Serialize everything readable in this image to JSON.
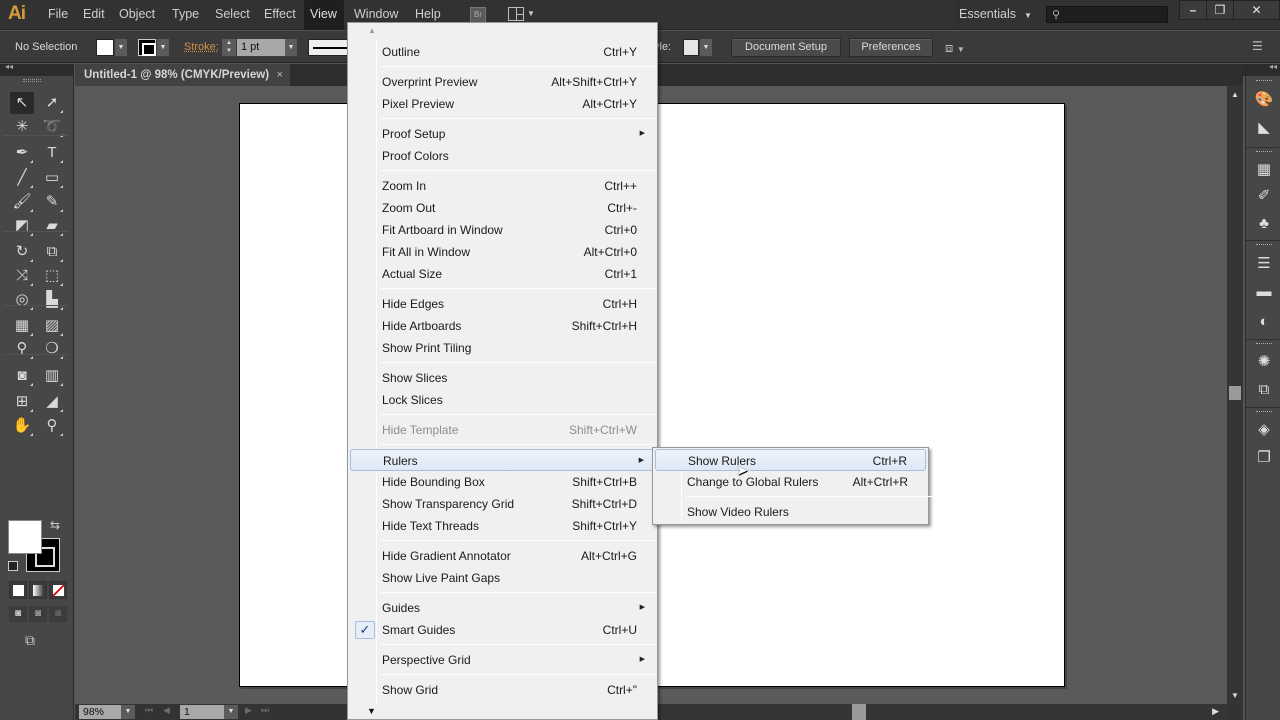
{
  "app": {
    "logo": "Ai",
    "menus": [
      {
        "label": "File"
      },
      {
        "label": "Edit"
      },
      {
        "label": "Object"
      },
      {
        "label": "Type"
      },
      {
        "label": "Select"
      },
      {
        "label": "Effect"
      },
      {
        "label": "View",
        "active": true
      },
      {
        "label": "Window"
      },
      {
        "label": "Help"
      }
    ],
    "bridge_label": "Br",
    "workspace": "Essentials",
    "search_placeholder": "",
    "window_controls": {
      "minimize": "–",
      "restore": "❐",
      "close": "✕"
    }
  },
  "controlbar": {
    "selection_status": "No Selection",
    "stroke_label": "Stroke:",
    "stroke_weight": "1 pt",
    "style_label": "yle:",
    "document_setup_label": "Document Setup",
    "preferences_label": "Preferences"
  },
  "document": {
    "tab_title": "Untitled-1 @ 98% (CMYK/Preview)",
    "tab_close": "×"
  },
  "statusbar": {
    "zoom": "98%",
    "artboard_number": "1"
  },
  "tools": [
    {
      "name": "selection-tool",
      "glyph": "↖",
      "selected": true
    },
    {
      "name": "direct-selection-tool",
      "glyph": "➚"
    },
    {
      "name": "magic-wand-tool",
      "glyph": "✳"
    },
    {
      "name": "lasso-tool",
      "glyph": "➰"
    },
    {
      "name": "pen-tool",
      "glyph": "✒"
    },
    {
      "name": "type-tool",
      "glyph": "T"
    },
    {
      "name": "line-segment-tool",
      "glyph": "╱"
    },
    {
      "name": "rectangle-tool",
      "glyph": "▭"
    },
    {
      "name": "paintbrush-tool",
      "glyph": "🖌"
    },
    {
      "name": "pencil-tool",
      "glyph": "✎"
    },
    {
      "name": "blob-brush-tool",
      "glyph": "◩"
    },
    {
      "name": "eraser-tool",
      "glyph": "▰"
    },
    {
      "name": "rotate-tool",
      "glyph": "↻"
    },
    {
      "name": "scale-tool",
      "glyph": "⧉"
    },
    {
      "name": "width-tool",
      "glyph": "⤨"
    },
    {
      "name": "free-transform-tool",
      "glyph": "⬚"
    },
    {
      "name": "shape-builder-tool",
      "glyph": "◎"
    },
    {
      "name": "perspective-grid-tool",
      "glyph": "▙"
    },
    {
      "name": "mesh-tool",
      "glyph": "▦"
    },
    {
      "name": "gradient-tool",
      "glyph": "▨"
    },
    {
      "name": "eyedropper-tool",
      "glyph": "⚲"
    },
    {
      "name": "blend-tool",
      "glyph": "❍"
    },
    {
      "name": "symbol-sprayer-tool",
      "glyph": "◙"
    },
    {
      "name": "column-graph-tool",
      "glyph": "▥"
    },
    {
      "name": "artboard-tool",
      "glyph": "⊞"
    },
    {
      "name": "slice-tool",
      "glyph": "◢"
    },
    {
      "name": "hand-tool",
      "glyph": "✋"
    },
    {
      "name": "zoom-tool",
      "glyph": "⚲"
    }
  ],
  "dock_panels": [
    {
      "name": "color-panel-icon",
      "glyph": "🎨"
    },
    {
      "name": "color-guide-panel-icon",
      "glyph": "◣"
    },
    {
      "name": "swatches-panel-icon",
      "glyph": "▦"
    },
    {
      "name": "brushes-panel-icon",
      "glyph": "✐"
    },
    {
      "name": "symbols-panel-icon",
      "glyph": "♣"
    },
    {
      "name": "stroke-panel-icon",
      "glyph": "☰"
    },
    {
      "name": "gradient-panel-icon",
      "glyph": "▬"
    },
    {
      "name": "transparency-panel-icon",
      "glyph": "◐"
    },
    {
      "name": "appearance-panel-icon",
      "glyph": "✺"
    },
    {
      "name": "graphic-styles-panel-icon",
      "glyph": "⧉"
    },
    {
      "name": "layers-panel-icon",
      "glyph": "◈"
    },
    {
      "name": "artboards-panel-icon",
      "glyph": "❐"
    }
  ],
  "view_menu": {
    "items": [
      {
        "label": "Outline",
        "shortcut": "Ctrl+Y"
      },
      {
        "separator": true
      },
      {
        "label": "Overprint Preview",
        "shortcut": "Alt+Shift+Ctrl+Y"
      },
      {
        "label": "Pixel Preview",
        "shortcut": "Alt+Ctrl+Y"
      },
      {
        "separator": true
      },
      {
        "label": "Proof Setup",
        "submenu": true
      },
      {
        "label": "Proof Colors"
      },
      {
        "separator": true
      },
      {
        "label": "Zoom In",
        "shortcut": "Ctrl++"
      },
      {
        "label": "Zoom Out",
        "shortcut": "Ctrl+-"
      },
      {
        "label": "Fit Artboard in Window",
        "shortcut": "Ctrl+0"
      },
      {
        "label": "Fit All in Window",
        "shortcut": "Alt+Ctrl+0"
      },
      {
        "label": "Actual Size",
        "shortcut": "Ctrl+1"
      },
      {
        "separator": true
      },
      {
        "label": "Hide Edges",
        "shortcut": "Ctrl+H"
      },
      {
        "label": "Hide Artboards",
        "shortcut": "Shift+Ctrl+H"
      },
      {
        "label": "Show Print Tiling"
      },
      {
        "separator": true
      },
      {
        "label": "Show Slices"
      },
      {
        "label": "Lock Slices"
      },
      {
        "separator": true
      },
      {
        "label": "Hide Template",
        "shortcut": "Shift+Ctrl+W",
        "disabled": true
      },
      {
        "separator": true
      },
      {
        "label": "Rulers",
        "submenu": true,
        "highlighted": true
      },
      {
        "label": "Hide Bounding Box",
        "shortcut": "Shift+Ctrl+B"
      },
      {
        "label": "Show Transparency Grid",
        "shortcut": "Shift+Ctrl+D"
      },
      {
        "label": "Hide Text Threads",
        "shortcut": "Shift+Ctrl+Y"
      },
      {
        "separator": true
      },
      {
        "label": "Hide Gradient Annotator",
        "shortcut": "Alt+Ctrl+G"
      },
      {
        "label": "Show Live Paint Gaps"
      },
      {
        "separator": true
      },
      {
        "label": "Guides",
        "submenu": true
      },
      {
        "label": "Smart Guides",
        "shortcut": "Ctrl+U",
        "checked": true
      },
      {
        "separator": true
      },
      {
        "label": "Perspective Grid",
        "submenu": true
      },
      {
        "separator": true
      },
      {
        "label": "Show Grid",
        "shortcut": "Ctrl+\""
      }
    ]
  },
  "rulers_submenu": {
    "items": [
      {
        "label": "Show Rulers",
        "shortcut": "Ctrl+R",
        "highlighted": true
      },
      {
        "label": "Change to Global Rulers",
        "shortcut": "Alt+Ctrl+R"
      },
      {
        "separator": true
      },
      {
        "label": "Show Video Rulers"
      }
    ]
  }
}
